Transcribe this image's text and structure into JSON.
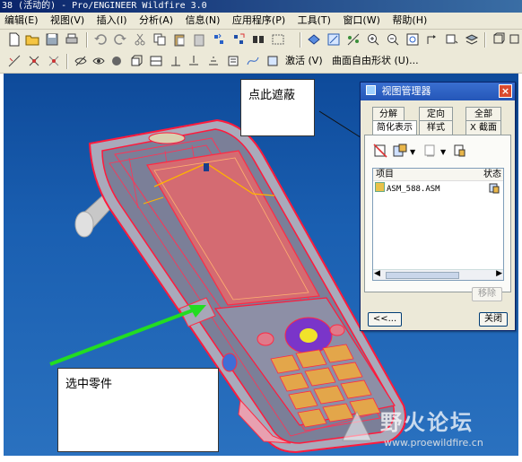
{
  "window": {
    "title": "38 (活动的) - Pro/ENGINEER Wildfire 3.0"
  },
  "menu": [
    "编辑(E)",
    "视图(V)",
    "插入(I)",
    "分析(A)",
    "信息(N)",
    "应用程序(P)",
    "工具(T)",
    "窗口(W)",
    "帮助(H)"
  ],
  "toolbar2": {
    "blend_label": "激活 (V)",
    "freeform_label": "曲面自由形状 (U)..."
  },
  "callouts": {
    "hide": "点此遮蔽",
    "select": "选中零件"
  },
  "view_manager": {
    "title": "视图管理器",
    "close": "×",
    "tabs_top": [
      "分解",
      "定向",
      "全部"
    ],
    "tabs_bottom": [
      "简化表示",
      "样式",
      "X 截面"
    ],
    "column_item": "项目",
    "column_status": "状态",
    "rows": [
      {
        "name": "ASM_588.ASM"
      }
    ],
    "remove_label": "移除",
    "back_label": "<<...",
    "close_label": "关闭"
  },
  "watermark": {
    "name": "野火论坛",
    "url": "www.proewildfire.cn"
  },
  "colors": {
    "viewport_blue": "#1a5fb1",
    "phone_red": "#ff1a3c",
    "screen_pink": "#d46b72",
    "arrow_green": "#22dd22"
  }
}
